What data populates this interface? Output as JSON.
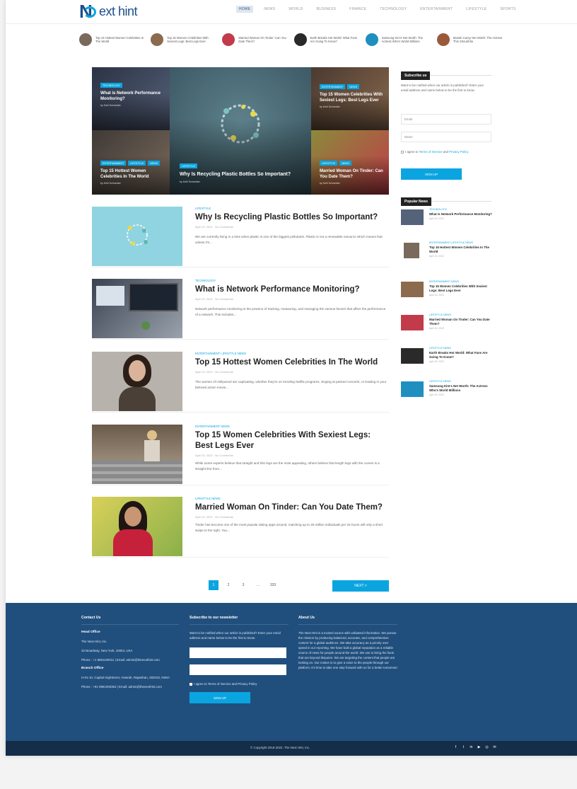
{
  "site": {
    "logo_text": "ext hint",
    "nav": [
      "HOME",
      "NEWS",
      "WORLD",
      "BUSINESS",
      "FINANCE",
      "TECHNOLOGY",
      "ENTERTAINMENT",
      "LIFESTYLE",
      "SPORTS"
    ]
  },
  "trending": [
    {
      "title": "Top 15 Hottest Women Celebrities In The World",
      "color": "#7a6a5c"
    },
    {
      "title": "Top 15 Women Celebrities With Sexiest Legs: Best Legs Ever",
      "color": "#8b6a4e"
    },
    {
      "title": "Married Woman On Tinder: Can You Date Them?",
      "color": "#c23b4a"
    },
    {
      "title": "Earth Breaks Hot World: What Fans Are Going To Know?",
      "color": "#2a2a2a"
    },
    {
      "title": "Samsung Kim's Net Worth: The Actress Who's World Millions",
      "color": "#1f8fbf"
    },
    {
      "title": "Mariah Carey Net Worth: The Actress This Should Be",
      "color": "#9a5a3a"
    }
  ],
  "hero": {
    "tl": {
      "tags": [
        "TECHNOLOGY"
      ],
      "title": "What is Network Performance Monitoring?",
      "meta": "by Kelli Schneider"
    },
    "bl": {
      "tags": [
        "ENTERTAINMENT",
        "LIFESTYLE",
        "NEWS"
      ],
      "title": "Top 15 Hottest Women Celebrities In The World",
      "meta": "by Kelli Schneider"
    },
    "center": {
      "tags": [
        "LIFESTYLE"
      ],
      "title": "Why Is Recycling Plastic Bottles So Important?",
      "meta": "by Kelli Schneider"
    },
    "tr": {
      "tags": [
        "ENTERTAINMENT",
        "NEWS"
      ],
      "title": "Top 15 Women Celebrities With Sexiest Legs: Best Legs Ever",
      "meta": "by Kelli Schneider"
    },
    "br": {
      "tags": [
        "LIFESTYLE",
        "NEWS"
      ],
      "title": "Married Woman On Tinder: Can You Date Them?",
      "meta": "by Kelli Schneider"
    }
  },
  "articles": [
    {
      "category": "LIFESTYLE",
      "title": "Why Is Recycling Plastic Bottles So Important?",
      "meta": "April 20, 2022 · No Comments",
      "excerpt": "We are currently living in a time when plastic is one of the biggest pollutants. Plastic is not a renewable resource which means that unless it's..."
    },
    {
      "category": "TECHNOLOGY",
      "title": "What is Network Performance Monitoring?",
      "meta": "April 20, 2022 · No Comments",
      "excerpt": "Network performance monitoring is the practice of tracking, measuring, and managing the various factors that affect the performance of a network. This includes..."
    },
    {
      "category": "ENTERTAINMENT LIFESTYLE NEWS",
      "title": "Top 15 Hottest Women Celebrities In The World",
      "meta": "April 20, 2022 · No Comments",
      "excerpt": "The women of Hollywood are captivating, whether they're on trending Netflix programs, singing at packed concerts, or leading in your beloved action movie..."
    },
    {
      "category": "ENTERTAINMENT NEWS",
      "title": "Top 15 Women Celebrities With Sexiest Legs: Best Legs Ever",
      "meta": "April 20, 2022 · No Comments",
      "excerpt": "While some experts believe that straight and thin legs are the most appealing, others believe that length legs with the curves is a straight line from..."
    },
    {
      "category": "LIFESTYLE NEWS",
      "title": "Married Woman On Tinder: Can You Date Them?",
      "meta": "April 20, 2022 · No Comments",
      "excerpt": "Tinder has become one of the most popular dating apps around, matching up to 26 million individuals per 24 hours will only a short swipe to the right. You..."
    }
  ],
  "pagination": {
    "pages": [
      "1",
      "2",
      "3",
      "...",
      "333"
    ],
    "next": "NEXT >"
  },
  "sidebar": {
    "subscribe_title": "Subscribe us",
    "subscribe_text": "Want to be notified when our article is published? Enter your email address and name below to be the first to know.",
    "email_placeholder": "Email",
    "name_placeholder": "Name",
    "agree_prefix": "I agree to",
    "agree_link1": "Terms of Service",
    "agree_and": "and",
    "agree_link2": "Privacy Policy",
    "signup": "SIGN UP",
    "popular_title": "Popular News",
    "popular": [
      {
        "cat": "TECHNOLOGY",
        "title": "What is Network Performance Monitoring?",
        "date": "April 20, 2022",
        "color": "#54627a"
      },
      {
        "cat": "ENTERTAINMENT LIFESTYLE NEWS",
        "title": "Top 15 Hottest Women Celebrities In The World",
        "date": "April 20, 2022",
        "color": "#7a6a5c"
      },
      {
        "cat": "ENTERTAINMENT NEWS",
        "title": "Top 15 Women Celebrities With Sexiest Legs: Best Legs Ever",
        "date": "April 20, 2022",
        "color": "#8b6a4e"
      },
      {
        "cat": "LIFESTYLE NEWS",
        "title": "Married Woman On Tinder: Can You Date Them?",
        "date": "April 20, 2022",
        "color": "#c23b4a"
      },
      {
        "cat": "LIFESTYLE NEWS",
        "title": "Earth Breaks Hot World: What Fans Are Going To Know?",
        "date": "April 20, 2022",
        "color": "#2a2a2a"
      },
      {
        "cat": "LIFESTYLE NEWS",
        "title": "Samsung Kim's Net Worth: The Actress Who's World Millions",
        "date": "April 20, 2022",
        "color": "#1f8fbf"
      }
    ]
  },
  "footer": {
    "contact_title": "Contact Us",
    "head_office": "Head Office",
    "company": "The Next Hint, Inc.",
    "address": "32 Broadway, New York, 10004, USA",
    "phone1": "Phone : +1 9661100011 | Email: admin@thenexthint.com",
    "branch_office": "Branch Office",
    "branch_address": "H-01-10, Capital HighStreet, Howrah, Rajasthan, 302018, INDIA",
    "phone2": "Phone : +91 9951000353 | Email: admin@thenexthint.com",
    "newsletter_title": "Subscribe to our newsletter",
    "newsletter_text": "Want to be notified when our article is published? Enter your email address and name below to be the first to know.",
    "agree": "I agree to Terms of Service and Privacy Policy",
    "signup": "SIGN UP",
    "about_title": "About Us",
    "about_text": "The Next Hint is a trusted source with unbiased information. We pursue the mission by producing balanced, accurate, and comprehensive content for a global audience. We take accuracy as a priority over speed in our reporting. We have built a global reputation as a reliable source of news for people around the world. We use to bring the facts that are beyond disputes. We are targeting the content that people are looking on. Our motive is to give a voice to the people through our platform. It's time to take one step forward with us for a better tomorrow!",
    "copyright": "© Copyright 2018-2022. The Next Hint, Inc.",
    "socials": [
      "f",
      "t",
      "in",
      "▶",
      "◎",
      "✉"
    ]
  }
}
